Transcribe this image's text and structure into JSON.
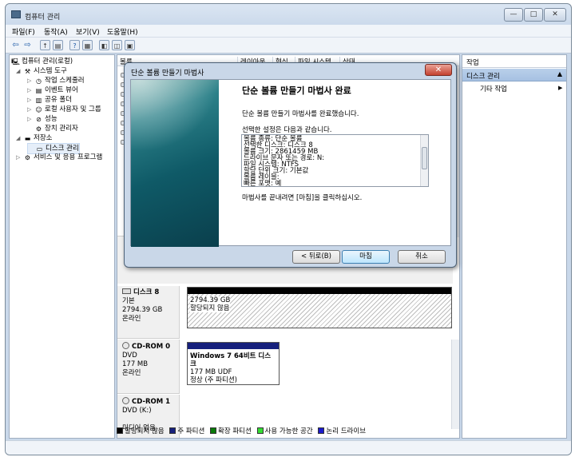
{
  "window": {
    "title": "컴퓨터 관리"
  },
  "menu": [
    "파일(F)",
    "동작(A)",
    "보기(V)",
    "도움말(H)"
  ],
  "tree": {
    "root": "컴퓨터 관리(로컬)",
    "system_tools": "시스템 도구",
    "task_scheduler": "작업 스케줄러",
    "event_viewer": "이벤트 뷰어",
    "shared_folders": "공유 폴더",
    "local_users": "로컬 사용자 및 그룹",
    "performance": "성능",
    "device_manager": "장치 관리자",
    "storage": "저장소",
    "disk_management": "디스크 관리",
    "services": "서비스 및 응용 프로그램"
  },
  "columns": [
    "볼륨",
    "레이아웃",
    "형식",
    "파일 시스템",
    "상태"
  ],
  "disks": [
    {
      "name": "디스크 8",
      "type": "기본",
      "size": "2794.39 GB",
      "status": "온라인",
      "partition": {
        "size": "2794.39 GB",
        "label": "할당되지 않음"
      }
    },
    {
      "name": "CD-ROM 0",
      "type": "DVD",
      "size": "177 MB",
      "status": "온라인",
      "partition": {
        "title": "Windows 7 64비트 디스크",
        "detail": "177 MB UDF",
        "state": "정상 (주 파티션)"
      }
    },
    {
      "name": "CD-ROM 1",
      "type": "DVD (K:)",
      "size": "",
      "status": "미디어 없음"
    }
  ],
  "legend": [
    {
      "label": "할당되지 않음",
      "color": "#000000"
    },
    {
      "label": "주 파티션",
      "color": "#16207c"
    },
    {
      "label": "확장 파티션",
      "color": "#0a7a0a"
    },
    {
      "label": "사용 가능한 공간",
      "color": "#33dd33"
    },
    {
      "label": "논리 드라이브",
      "color": "#1a1acc"
    }
  ],
  "actions": {
    "header": "작업",
    "section": "디스크 관리",
    "item": "기타 작업"
  },
  "dialog": {
    "title": "단순 볼륨 만들기 마법사",
    "heading": "단순 볼륨 만들기 마법사 완료",
    "intro": "단순 볼륨 만들기 마법사를 완료했습니다.",
    "settings_label": "선택한 설정은 다음과 같습니다.",
    "summary": [
      "볼륨 종류: 단순 볼륨",
      "선택한 디스크: 디스크 8",
      "볼륨 크기: 2861459 MB",
      "드라이브 문자 또는 경로: N:",
      "파일 시스템: NTFS",
      "할당 단위 크기: 기본값",
      "볼륨 레이블:",
      "빠른 포맷: 예"
    ],
    "finish_note": "마법사를 끝내려면 [마침]을 클릭하십시오.",
    "back": "< 뒤로(B)",
    "finish": "마침",
    "cancel": "취소"
  }
}
